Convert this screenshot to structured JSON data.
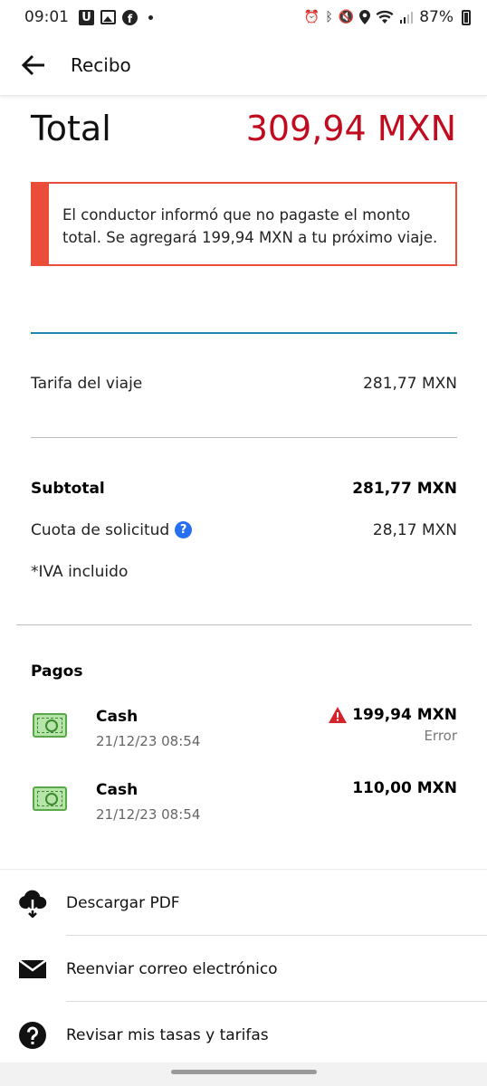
{
  "status_bar": {
    "time": "09:01",
    "battery": "87%",
    "left_icons": [
      "uber-app-icon",
      "gallery-icon",
      "facebook-icon"
    ],
    "right_icons": [
      "alarm-icon",
      "bluetooth-icon",
      "mute-icon",
      "location-icon",
      "wifi-icon",
      "signal-icon",
      "battery-icon"
    ]
  },
  "header": {
    "title": "Recibo"
  },
  "total": {
    "label": "Total",
    "value": "309,94 MXN",
    "value_color": "#c10b1f"
  },
  "alert": {
    "message": "El conductor informó que no pagaste el monto total. Se agregará 199,94 MXN a tu próximo viaje.",
    "accent_color": "#ea4e3a"
  },
  "fare": {
    "label": "Tarifa del viaje",
    "value": "281,77 MXN"
  },
  "summary": {
    "subtotal_label": "Subtotal",
    "subtotal_value": "281,77 MXN",
    "fee_label": "Cuota de solicitud",
    "fee_help": "?",
    "fee_value": "28,17 MXN",
    "tax_note": "*IVA incluido"
  },
  "payments": {
    "title": "Pagos",
    "items": [
      {
        "method": "Cash",
        "date": "21/12/23 08:54",
        "amount": "199,94 MXN",
        "status": "Error",
        "icon": "cash-icon"
      },
      {
        "method": "Cash",
        "date": "21/12/23 08:54",
        "amount": "110,00 MXN",
        "icon": "cash-icon"
      }
    ]
  },
  "actions": [
    {
      "label": "Descargar PDF",
      "icon": "cloud-download-icon"
    },
    {
      "label": "Reenviar correo electrónico",
      "icon": "mail-icon"
    },
    {
      "label": "Revisar mis tasas y tarifas",
      "icon": "help-circle-icon"
    }
  ]
}
